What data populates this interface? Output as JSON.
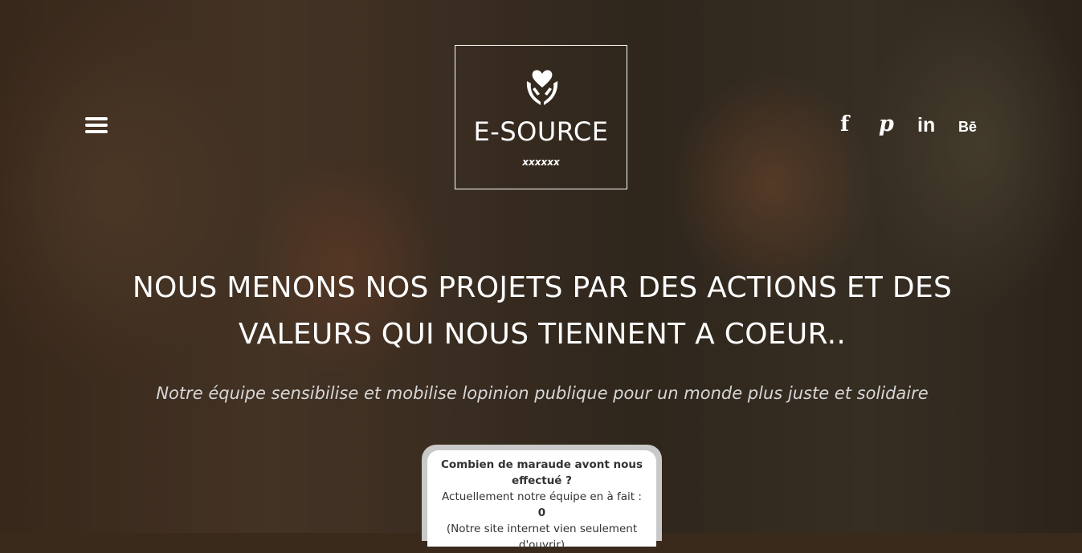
{
  "header": {
    "logo_title": "E-SOURCE",
    "logo_subtitle": "xxxxxx",
    "social": {
      "facebook": "f",
      "pinterest": "p",
      "linkedin": "in",
      "behance": "Bē"
    }
  },
  "hero": {
    "headline": "NOUS MENONS NOS PROJETS PAR DES ACTIONS ET DES VALEURS QUI NOUS TIENNENT A COEUR..",
    "subheadline": "Notre équipe sensibilise et mobilise lopinion publique pour un monde plus juste et solidaire"
  },
  "stats": {
    "question": "Combien de maraude avont nous effectué ?",
    "prefix": "Actuellement notre équipe en à fait : ",
    "count": "0",
    "note": "(Notre site internet vien seulement d'ouvrir)"
  },
  "icons": {
    "menu": "hamburger-menu-icon",
    "logo": "heart-hands-icon"
  }
}
